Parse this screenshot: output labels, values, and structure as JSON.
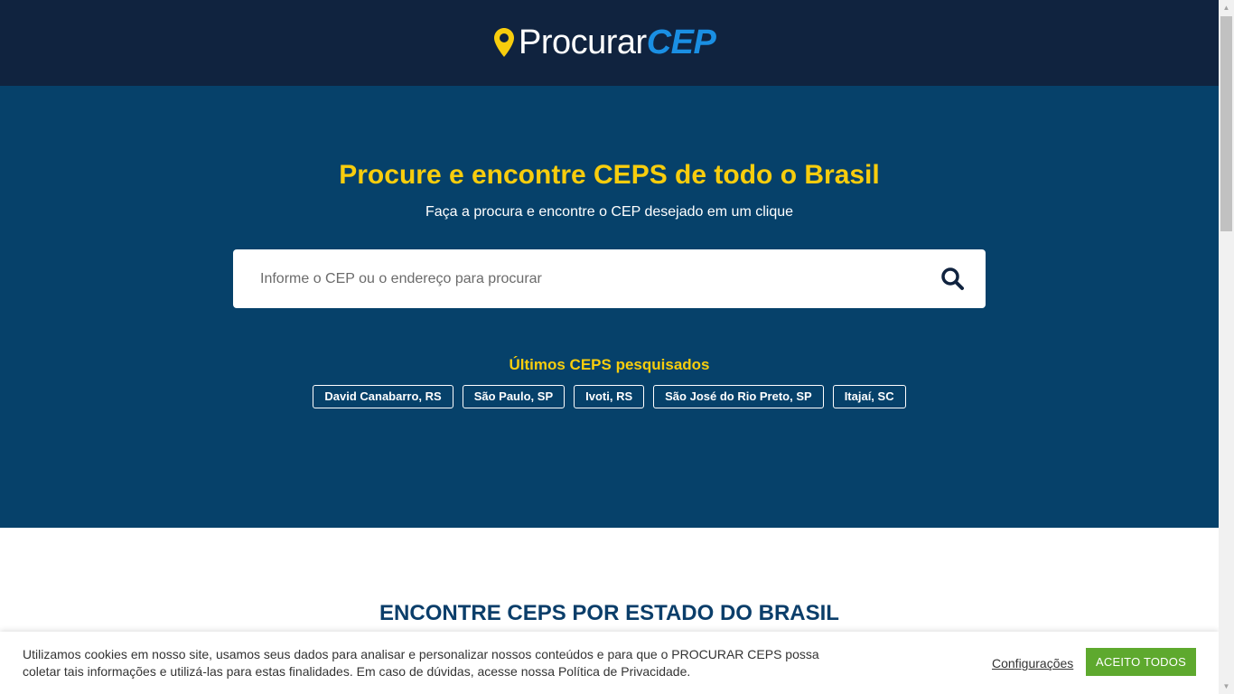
{
  "brand": {
    "logo_part1": "Procurar",
    "logo_part2": "CEP",
    "pin_color": "#f8cd0d",
    "accent_color": "#1a8fe3"
  },
  "hero": {
    "title": "Procure e encontre CEPS de todo o Brasil",
    "subtitle": "Faça a procura e encontre o CEP desejado em um clique",
    "search_placeholder": "Informe o CEP ou o endereço para procurar",
    "search_icon": "search-icon",
    "recent_title": "Últimos CEPS pesquisados",
    "recent": [
      "David Canabarro, RS",
      "São Paulo, SP",
      "Ivoti, RS",
      "São José do Rio Preto, SP",
      "Itajaí, SC"
    ]
  },
  "states_section": {
    "title": "ENCONTRE CEPS POR ESTADO DO BRASIL"
  },
  "cookie_bar": {
    "text": "Utilizamos cookies em nosso site, usamos seus dados para analisar e personalizar nossos conteúdos e para que o PROCURAR CEPS possa coletar tais informações e utilizá-las para estas finalidades. Em caso de dúvidas, acesse nossa Política de Privacidade.",
    "settings_label": "Configurações",
    "accept_label": "ACEITO TODOS",
    "accept_color": "#5ea92e"
  },
  "colors": {
    "header_bg": "#10233f",
    "hero_bg": "#06416a",
    "highlight_yellow": "#f8cd0d",
    "section_title": "#0b3e6a"
  }
}
